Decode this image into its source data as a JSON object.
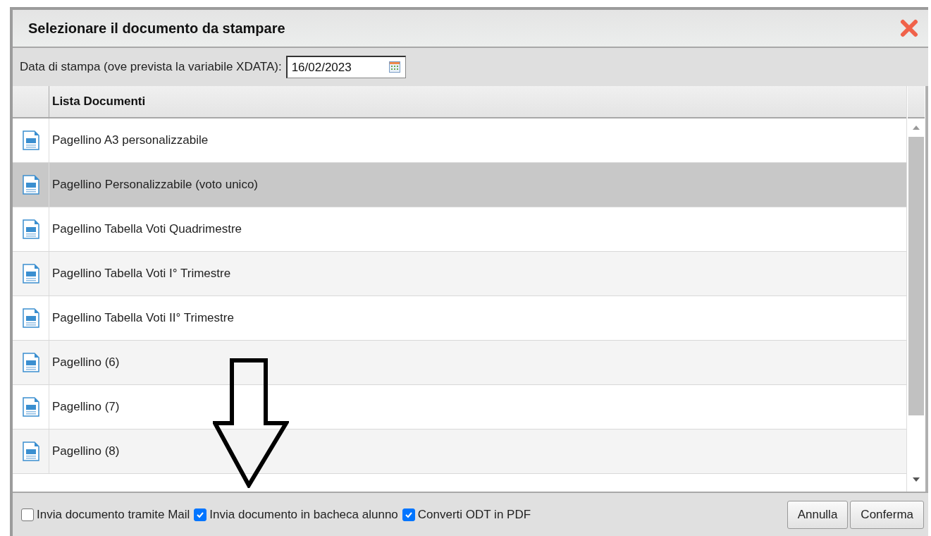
{
  "dialog": {
    "title": "Selezionare il documento da stampare"
  },
  "print_date": {
    "label": "Data di stampa (ove prevista la variabile XDATA):",
    "value": "16/02/2023"
  },
  "table": {
    "columns": [
      "Lista Documenti"
    ],
    "rows": [
      {
        "label": "Pagellino A3 personalizzabile",
        "selected": false
      },
      {
        "label": "Pagellino Personalizzabile (voto unico)",
        "selected": true
      },
      {
        "label": "Pagellino Tabella Voti Quadrimestre",
        "selected": false
      },
      {
        "label": "Pagellino Tabella Voti I° Trimestre",
        "selected": false
      },
      {
        "label": "Pagellino Tabella Voti II° Trimestre",
        "selected": false
      },
      {
        "label": "Pagellino (6)",
        "selected": false
      },
      {
        "label": "Pagellino (7)",
        "selected": false
      },
      {
        "label": "Pagellino (8)",
        "selected": false
      }
    ]
  },
  "options": [
    {
      "label": "Invia documento tramite Mail",
      "checked": false
    },
    {
      "label": "Invia documento in bacheca alunno",
      "checked": true
    },
    {
      "label": "Converti ODT in PDF",
      "checked": true
    }
  ],
  "buttons": [
    "Annulla",
    "Conferma"
  ]
}
